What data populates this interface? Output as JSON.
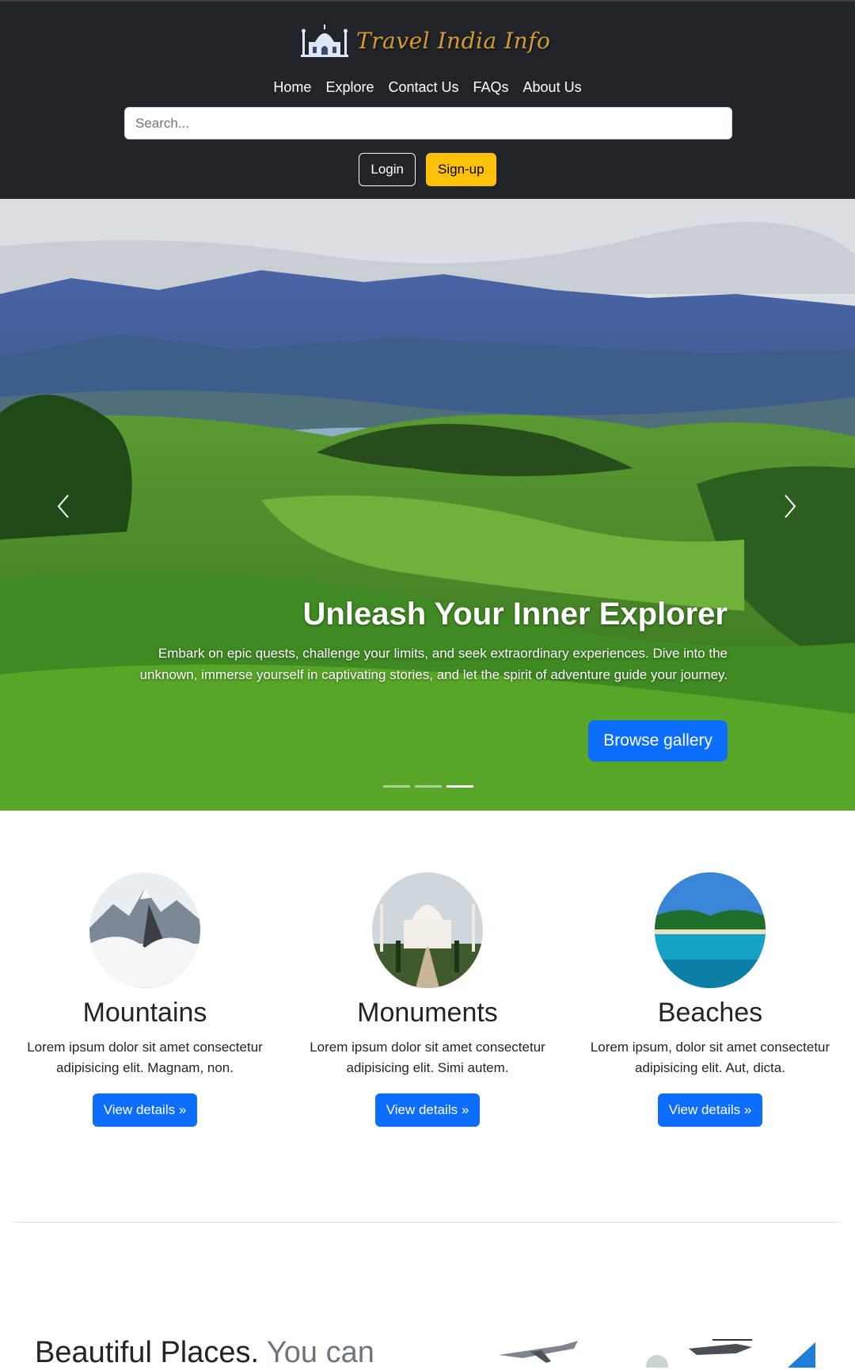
{
  "brand": {
    "name": "Travel India Info",
    "logo_icon": "taj-mahal-icon"
  },
  "nav": {
    "links": [
      "Home",
      "Explore",
      "Contact Us",
      "FAQs",
      "About Us"
    ]
  },
  "search": {
    "placeholder": "Search...",
    "value": ""
  },
  "auth": {
    "login_label": "Login",
    "signup_label": "Sign-up"
  },
  "hero": {
    "title": "Unleash Your Inner Explorer",
    "text": "Embark on epic quests, challenge your limits, and seek extraordinary experiences. Dive into the unknown, immerse yourself in captivating stories, and let the spirit of adventure guide your journey.",
    "button_label": "Browse gallery",
    "prev_icon": "chevron-left-icon",
    "next_icon": "chevron-right-icon",
    "slide_count": 3,
    "active_slide": 3
  },
  "features": [
    {
      "title": "Mountains",
      "text": "Lorem ipsum dolor sit amet consectetur adipisicing elit. Magnam, non.",
      "button_label": "View details »"
    },
    {
      "title": "Monuments",
      "text": "Lorem ipsum dolor sit amet consectetur adipisicing elit. Simi autem.",
      "button_label": "View details »"
    },
    {
      "title": "Beaches",
      "text": "Lorem ipsum, dolor sit amet consectetur adipisicing elit. Aut, dicta.",
      "button_label": "View details »"
    }
  ],
  "featurette": {
    "heading": "Beautiful Places.",
    "muted": "You can"
  },
  "colors": {
    "navbar_bg": "#212529",
    "primary": "#0d6efd",
    "warning": "#ffc107",
    "brand_gold": "#d69a2d"
  }
}
